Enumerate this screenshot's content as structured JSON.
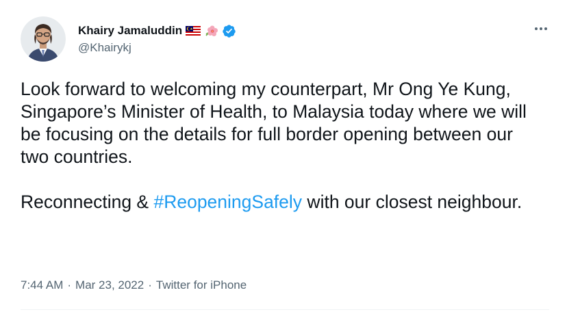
{
  "author": {
    "display_name": "Khairy Jamaluddin",
    "handle": "@Khairykj",
    "verified": true,
    "flag_emoji": "malaysia-flag-icon",
    "flower_emoji": "hibiscus-icon"
  },
  "tweet": {
    "paragraph1": "Look forward to welcoming my counterpart, Mr Ong Ye Kung, Singapore’s Minister of Health, to Malaysia today where we will be focusing on the details for full border opening between our two countries.",
    "paragraph2_before": "Reconnecting & ",
    "hashtag": "#ReopeningSafely",
    "paragraph2_after": " with our closest neighbour."
  },
  "meta": {
    "time": "7:44 AM",
    "separator": "·",
    "date": "Mar 23, 2022",
    "source": "Twitter for iPhone"
  },
  "colors": {
    "accent": "#1d9bf0",
    "text": "#0f1419",
    "secondary": "#536471"
  }
}
